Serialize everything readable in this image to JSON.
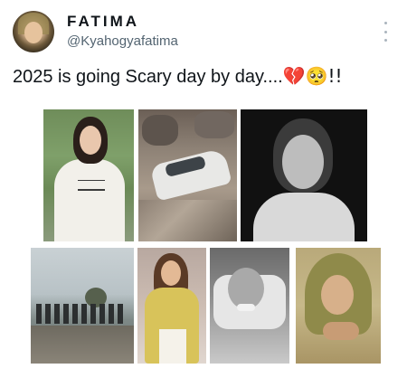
{
  "author": {
    "display_name": "FATIMA",
    "handle": "@Kyahogyafatima",
    "avatar_icon": "profile-avatar"
  },
  "tweet": {
    "text": "2025 is going Scary day by day....",
    "emojis": "💔🥺!!"
  },
  "menu": {
    "icon": "more-options-icon"
  },
  "media": {
    "images": [
      {
        "name": "photo-girl-white-shirt"
      },
      {
        "name": "photo-crushed-car-rubble"
      },
      {
        "name": "photo-older-woman-bw"
      },
      {
        "name": "photo-flood-people"
      },
      {
        "name": "photo-woman-yellow-dress"
      },
      {
        "name": "photo-patient-hospital-bw"
      },
      {
        "name": "photo-painting-veiled-woman"
      }
    ]
  },
  "colors": {
    "text": "#0f1419",
    "secondary": "#536471",
    "background": "#ffffff"
  }
}
